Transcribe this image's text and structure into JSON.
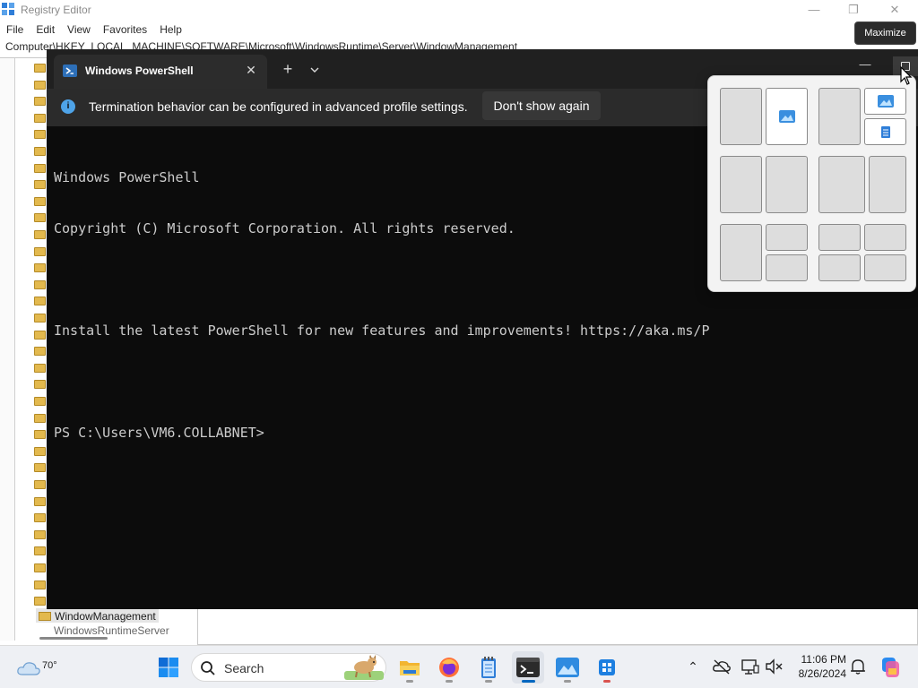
{
  "regedit": {
    "title": "Registry Editor",
    "menu": [
      "File",
      "Edit",
      "View",
      "Favorites",
      "Help"
    ],
    "address": "Computer\\HKEY_LOCAL_MACHINE\\SOFTWARE\\Microsoft\\WindowsRuntime\\Server\\WindowManagement",
    "selected_key": "WindowManagement",
    "next_key": "WindowsRuntimeServer"
  },
  "terminal": {
    "tab_title": "Windows PowerShell",
    "info_message": "Termination behavior can be configured in advanced profile settings.",
    "info_button": "Don't show again",
    "console_lines": [
      "Windows PowerShell",
      "Copyright (C) Microsoft Corporation. All rights reserved.",
      "",
      "Install the latest PowerShell for new features and improvements! https://aka.ms/P",
      "",
      "PS C:\\Users\\VM6.COLLABNET>"
    ]
  },
  "tooltip": "Maximize",
  "taskbar": {
    "weather_temp": "70°",
    "search_label": "Search",
    "time": "11:06 PM",
    "date": "8/26/2024",
    "icons": [
      "windows-start-icon",
      "file-explorer-icon",
      "firefox-icon",
      "notepad-icon",
      "terminal-icon",
      "photos-icon",
      "azure-devops-icon"
    ]
  },
  "colors": {
    "terminal_bg": "#0c0c0c",
    "accent": "#0067c0",
    "folder": "#e3b94e"
  }
}
